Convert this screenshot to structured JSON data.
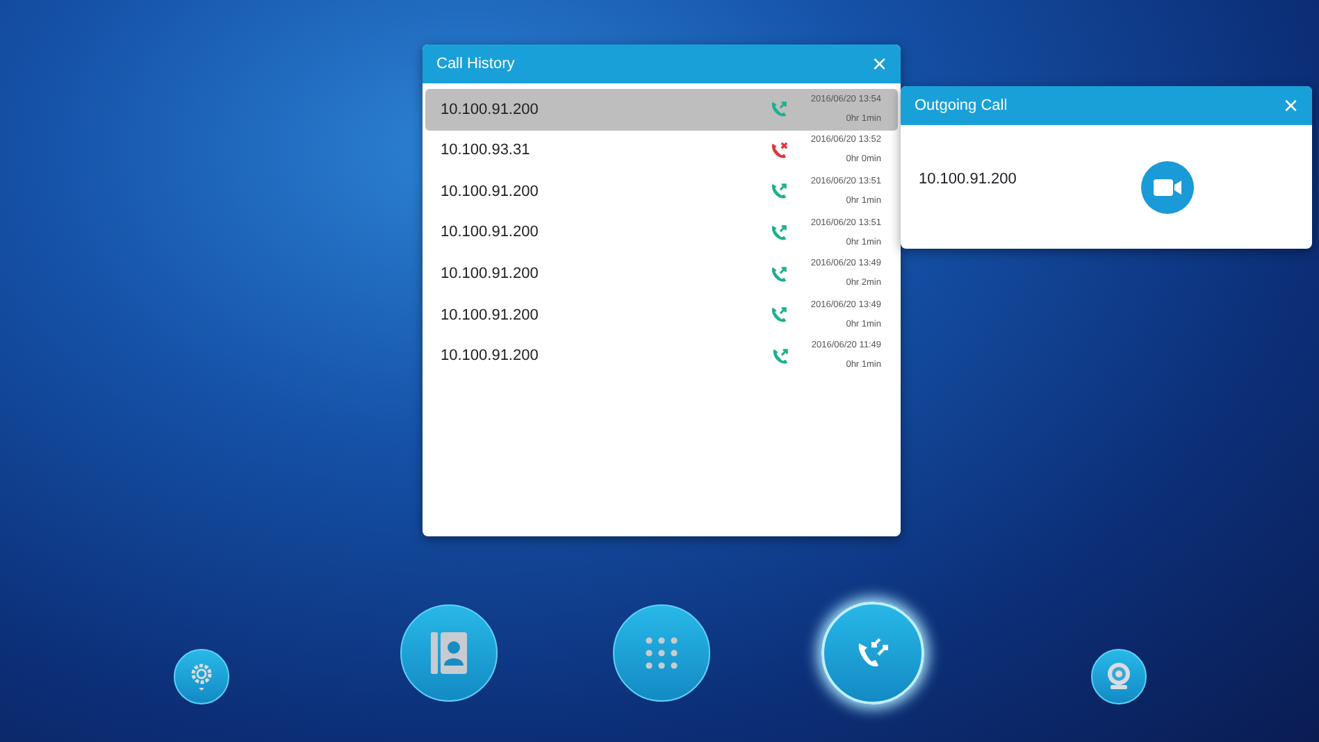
{
  "call_history": {
    "title": "Call History",
    "close": "×",
    "rows": [
      {
        "address": "10.100.91.200",
        "kind": "outgoing",
        "time": "2016/06/20 13:54",
        "duration": "0hr 1min",
        "selected": true
      },
      {
        "address": "10.100.93.31",
        "kind": "missed",
        "time": "2016/06/20 13:52",
        "duration": "0hr 0min",
        "selected": false
      },
      {
        "address": "10.100.91.200",
        "kind": "outgoing",
        "time": "2016/06/20 13:51",
        "duration": "0hr 1min",
        "selected": false
      },
      {
        "address": "10.100.91.200",
        "kind": "outgoing",
        "time": "2016/06/20 13:51",
        "duration": "0hr 1min",
        "selected": false
      },
      {
        "address": "10.100.91.200",
        "kind": "outgoing",
        "time": "2016/06/20 13:49",
        "duration": "0hr 2min",
        "selected": false
      },
      {
        "address": "10.100.91.200",
        "kind": "outgoing",
        "time": "2016/06/20 13:49",
        "duration": "0hr 1min",
        "selected": false
      },
      {
        "address": "10.100.91.200",
        "kind": "outgoing",
        "time": "2016/06/20 11:49",
        "duration": "0hr 1min",
        "selected": false
      }
    ]
  },
  "outgoing_call": {
    "title": "Outgoing Call",
    "close": "×",
    "address": "10.100.91.200"
  },
  "dock": [
    {
      "kind": "settings",
      "selected": false
    },
    {
      "kind": "contacts",
      "selected": false
    },
    {
      "kind": "dialpad",
      "selected": false
    },
    {
      "kind": "calls",
      "selected": true
    },
    {
      "kind": "camera",
      "selected": false
    }
  ]
}
